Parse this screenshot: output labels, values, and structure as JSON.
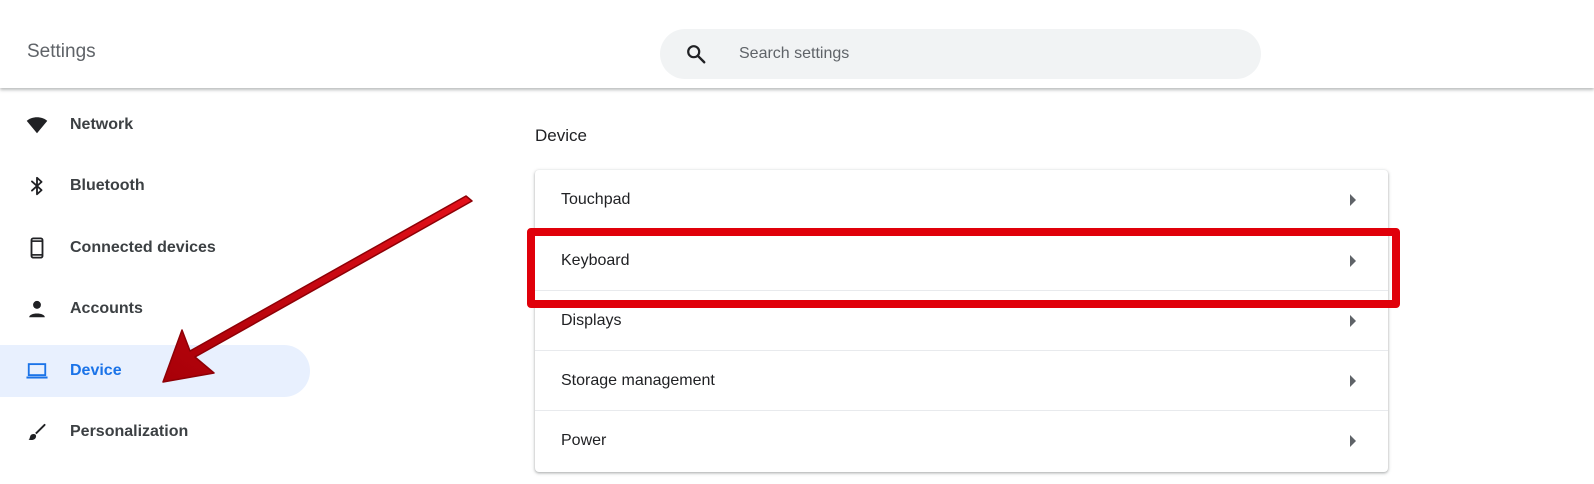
{
  "header": {
    "title": "Settings",
    "search": {
      "placeholder": "Search settings",
      "value": ""
    }
  },
  "sidebar": {
    "items": [
      {
        "label": "Network",
        "icon": "wifi-icon",
        "selected": false
      },
      {
        "label": "Bluetooth",
        "icon": "bluetooth-icon",
        "selected": false
      },
      {
        "label": "Connected devices",
        "icon": "phone-icon",
        "selected": false
      },
      {
        "label": "Accounts",
        "icon": "person-icon",
        "selected": false
      },
      {
        "label": "Device",
        "icon": "laptop-icon",
        "selected": true
      },
      {
        "label": "Personalization",
        "icon": "brush-icon",
        "selected": false
      }
    ]
  },
  "main": {
    "section_title": "Device",
    "rows": [
      {
        "label": "Touchpad"
      },
      {
        "label": "Keyboard",
        "highlighted": true
      },
      {
        "label": "Displays"
      },
      {
        "label": "Storage management"
      },
      {
        "label": "Power"
      }
    ]
  },
  "colors": {
    "accent": "#1a73e8",
    "selected_bg": "#e8f0fe",
    "annotation_red": "#e0000a"
  }
}
